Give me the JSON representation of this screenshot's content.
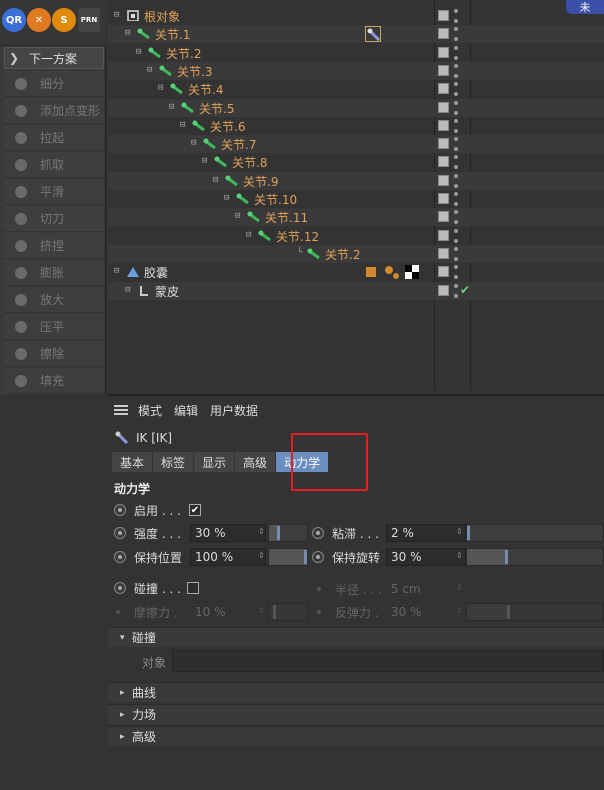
{
  "top_icons": [
    {
      "name": "qr-icon",
      "label": "QR",
      "color": "#3a6fd8"
    },
    {
      "name": "x-icon",
      "label": "✕",
      "color": "#e07a20"
    },
    {
      "name": "s-icon",
      "label": "S",
      "color": "#e08a10"
    },
    {
      "name": "prn-icon",
      "label": "PRN",
      "color": "#444"
    }
  ],
  "top_right_button": "未",
  "tool_palette": {
    "header": "下一方案",
    "tools": [
      "细分",
      "添加点变形",
      "拉起",
      "抓取",
      "平滑",
      "切刀",
      "挤捏",
      "膨胀",
      "放大",
      "压平",
      "擦除",
      "填充"
    ]
  },
  "outliner": {
    "rows": [
      {
        "label": "根对象",
        "indent": 0,
        "kind": "root",
        "color": "orange"
      },
      {
        "label": "关节.1",
        "indent": 1,
        "kind": "joint",
        "color": "orange",
        "tag": "ik"
      },
      {
        "label": "关节.2",
        "indent": 2,
        "kind": "joint",
        "color": "orange"
      },
      {
        "label": "关节.3",
        "indent": 3,
        "kind": "joint",
        "color": "orange"
      },
      {
        "label": "关节.4",
        "indent": 4,
        "kind": "joint",
        "color": "orange"
      },
      {
        "label": "关节.5",
        "indent": 5,
        "kind": "joint",
        "color": "orange"
      },
      {
        "label": "关节.6",
        "indent": 6,
        "kind": "joint",
        "color": "orange"
      },
      {
        "label": "关节.7",
        "indent": 7,
        "kind": "joint",
        "color": "orange"
      },
      {
        "label": "关节.8",
        "indent": 8,
        "kind": "joint",
        "color": "orange"
      },
      {
        "label": "关节.9",
        "indent": 9,
        "kind": "joint",
        "color": "orange"
      },
      {
        "label": "关节.10",
        "indent": 10,
        "kind": "joint",
        "color": "orange"
      },
      {
        "label": "关节.11",
        "indent": 11,
        "kind": "joint",
        "color": "orange"
      },
      {
        "label": "关节.12",
        "indent": 12,
        "kind": "joint",
        "color": "orange"
      },
      {
        "label": "关节.2",
        "indent": 13,
        "kind": "joint-last",
        "color": "orange"
      },
      {
        "label": "胶囊",
        "indent": 0,
        "kind": "capsule",
        "color": "white",
        "tag": "multi"
      },
      {
        "label": "蒙皮",
        "indent": 1,
        "kind": "skin",
        "color": "white",
        "check": true
      }
    ]
  },
  "attributes": {
    "menu": [
      "模式",
      "编辑",
      "用户数据"
    ],
    "object_title": "IK [IK]",
    "tabs": [
      "基本",
      "标签",
      "显示",
      "高级",
      "动力学"
    ],
    "active_tab": "动力学",
    "section": "动力学",
    "enable_label": "启用 . . .",
    "enable_checked": "✔",
    "strength_label": "强度 . . .",
    "strength_value": "30 %",
    "strength_fraction": 0.3,
    "damping_label": "粘滞 . . .",
    "damping_value": "2 %",
    "damping_fraction": 0.02,
    "keep_pos_label": "保持位置",
    "keep_pos_value": "100 %",
    "keep_pos_fraction": 1.0,
    "keep_rot_label": "保持旋转",
    "keep_rot_value": "30 %",
    "keep_rot_fraction": 0.3,
    "collision_label": "碰撞 . . .",
    "radius_label": "半径 . . .",
    "radius_value": "5 cm",
    "friction_label": "摩擦力 .",
    "friction_value": "10 %",
    "bounce_label": "反弹力 .",
    "bounce_value": "30 %",
    "groups": [
      {
        "label": "碰撞",
        "open": true
      },
      {
        "label": "曲线",
        "open": false
      },
      {
        "label": "力场",
        "open": false
      },
      {
        "label": "高级",
        "open": false
      }
    ],
    "object_field_label": "对象"
  }
}
